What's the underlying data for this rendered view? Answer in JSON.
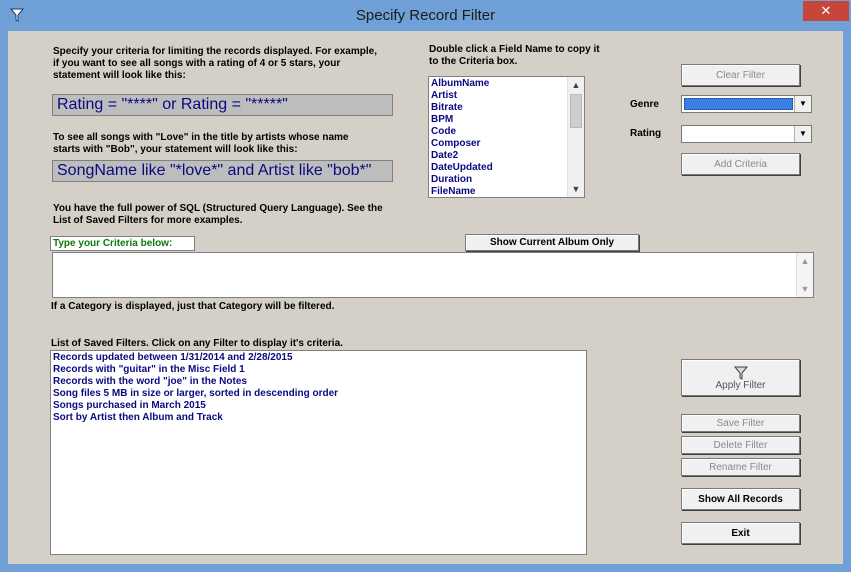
{
  "window": {
    "title": "Specify Record Filter",
    "close_glyph": "✕"
  },
  "help": {
    "intro": "Specify your criteria for limiting the records displayed.  For example,\nif you want to see all songs with a rating of 4 or 5 stars, your\nstatement will look like this:",
    "example1": "Rating = \"****\" or Rating = \"*****\"",
    "love_text": "To see all songs with \"Love\" in the title by artists whose name\nstarts with \"Bob\", your statement will look like this:",
    "example2": "SongName like \"*love*\" and Artist like \"bob*\"",
    "sql_text": "You have the full power of SQL (Structured Query Language).  See the\nList of Saved Filters for more examples.",
    "field_hint": "Double click a Field Name to copy it\nto the Criteria box."
  },
  "fields": [
    "AlbumName",
    "Artist",
    "Bitrate",
    "BPM",
    "Code",
    "Composer",
    "Date2",
    "DateUpdated",
    "Duration",
    "FileName"
  ],
  "controls": {
    "clear_filter": "Clear Filter",
    "genre_label": "Genre",
    "rating_label": "Rating",
    "add_criteria": "Add Criteria",
    "show_current_album": "Show Current Album Only",
    "criteria_label": "Type your Criteria below:",
    "category_note": "If a Category is displayed, just that Category will be filtered.",
    "saved_filters_label": "List of Saved Filters.  Click on any Filter to display it's criteria.",
    "apply_filter": "Apply Filter",
    "save_filter": "Save Filter",
    "delete_filter": "Delete Filter",
    "rename_filter": "Rename Filter",
    "show_all_records": "Show All Records",
    "exit": "Exit"
  },
  "saved_filters": [
    "Records updated between 1/31/2014 and 2/28/2015",
    "Records with \"guitar\" in the Misc Field 1",
    "Records with the word \"joe\" in the Notes",
    "Song files 5 MB in size or larger, sorted in descending order",
    "Songs purchased in March 2015",
    "Sort by Artist then Album and Track"
  ],
  "colors": {
    "titlebar": "#6fa0d8",
    "dialog": "#d4d0c8",
    "list_text": "#0a0a80",
    "criteria_label": "#0a7a0a",
    "genre_selection": "#3d7fe0",
    "close": "#c7453b"
  }
}
